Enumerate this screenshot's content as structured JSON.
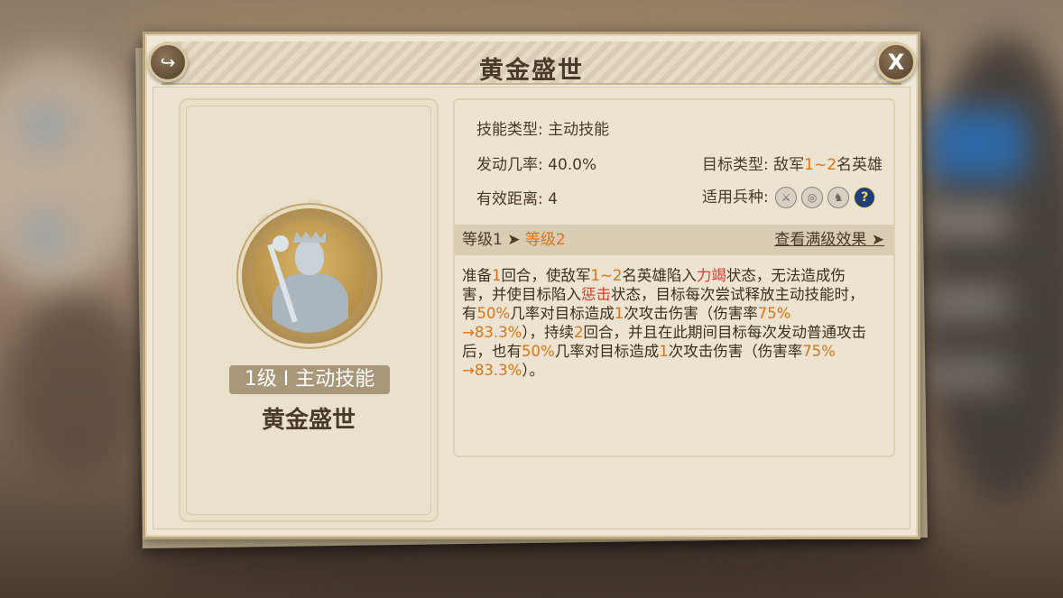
{
  "dialog": {
    "title": "黄金盛世",
    "share_icon": "share-icon",
    "close_label": "X"
  },
  "skill": {
    "level_tag": "1级 I 主动技能",
    "name": "黄金盛世"
  },
  "info": {
    "skill_type_label": "技能类型:",
    "skill_type_value": "主动技能",
    "trigger_rate_label": "发动几率:",
    "trigger_rate_value": "40.0%",
    "target_type_label": "目标类型:",
    "target_type_prefix": "敌军",
    "target_type_count": "1~2",
    "target_type_suffix": "名英雄",
    "range_label": "有效距离:",
    "range_value": "4",
    "troops_label": "适用兵种:",
    "troop_icons": [
      "sword-icon",
      "target-icon",
      "horse-icon",
      "help-icon"
    ],
    "help_glyph": "?"
  },
  "level_bar": {
    "current": "等级1",
    "arrow": "➤",
    "next": "等级2",
    "view_max": "查看满级效果",
    "view_max_arrow": "➤"
  },
  "description": {
    "segments": [
      {
        "t": "准备",
        "c": ""
      },
      {
        "t": "1",
        "c": "orange"
      },
      {
        "t": "回合，使敌军",
        "c": ""
      },
      {
        "t": "1~2",
        "c": "orange"
      },
      {
        "t": "名英雄陷入",
        "c": ""
      },
      {
        "t": "力竭",
        "c": "red"
      },
      {
        "t": "状态，无法造成伤害，并使目标陷入",
        "c": ""
      },
      {
        "t": "惩击",
        "c": "red"
      },
      {
        "t": "状态，目标每次尝试释放主动技能时，有",
        "c": ""
      },
      {
        "t": "50%",
        "c": "orange"
      },
      {
        "t": "几率对目标造成",
        "c": ""
      },
      {
        "t": "1",
        "c": "orange"
      },
      {
        "t": "次攻击伤害（伤害率",
        "c": ""
      },
      {
        "t": "75% →83.3%",
        "c": "orange"
      },
      {
        "t": "），持续",
        "c": ""
      },
      {
        "t": "2",
        "c": "orange"
      },
      {
        "t": "回合，并且在此期间目标每次发动普通攻击后，也有",
        "c": ""
      },
      {
        "t": "50%",
        "c": "orange"
      },
      {
        "t": "几率对目标造成",
        "c": ""
      },
      {
        "t": "1",
        "c": "orange"
      },
      {
        "t": "次攻击伤害（伤害率",
        "c": ""
      },
      {
        "t": "75% →83.3%",
        "c": "orange"
      },
      {
        "t": "）。",
        "c": ""
      }
    ]
  },
  "colors": {
    "accent_orange": "#d9741c",
    "accent_red": "#e03a2e",
    "text_brown": "#4a3a28"
  }
}
